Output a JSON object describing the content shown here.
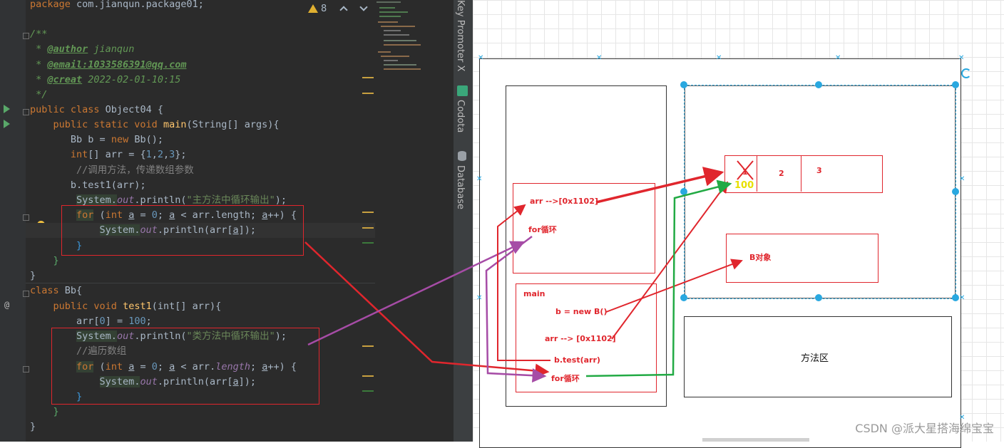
{
  "editor": {
    "warning_count": "8",
    "lines": {
      "pkg_kw": "package",
      "pkg_name": " com.jianqun.package01;",
      "doc_open": "/**",
      "doc_author_tag": "@author",
      "doc_author_val": " jianqun",
      "doc_email_tag": "@email:1033586391@qq.com",
      "doc_creat_tag": "@creat",
      "doc_creat_val": " 2022-02-01-10:15",
      "doc_close": " */",
      "class1_kw": "public class",
      "class1_name": " Object04 {",
      "main_kw": "public static void",
      "main_fn": "main",
      "main_args": "(String[] args){",
      "bb_decl": "Bb b = ",
      "kw_new": "new",
      "bb_ctor": " Bb();",
      "arr_type": "int",
      "arr_decl": "[] arr = {",
      "n1": "1",
      "n2": "2",
      "n3": "3",
      "arr_end": "};",
      "cmt_call": "//调用方法，传递数组参数",
      "call_test1": "b.test1(arr);",
      "sys": "System.",
      "out": "out",
      "println_open": ".println(",
      "str_main": "\"主方法中循环输出\"",
      "close_paren": ");",
      "kw_for": "for",
      "kw_int": "int",
      "var_a": "a",
      "zero": "0",
      "for_cond": " < arr.",
      "length": "length",
      "for_inc": "++) {",
      "arr_a": "arr[",
      "arr_a_end": "]);",
      "brace_close": "}",
      "class2_kw": "class",
      "class2_name": " Bb{",
      "test1_kw": "public void",
      "test1_fn": "test1",
      "test1_args": "(int[] arr){",
      "arr0": "arr[",
      "arr0_idx": "0",
      "arr0_assign": "] = ",
      "hundred": "100",
      "semi": ";",
      "str_class": "\"类方法中循环输出\"",
      "cmt_iter": "//遍历数组"
    }
  },
  "tool_windows": [
    "Key Promoter X",
    "Codota",
    "Database"
  ],
  "diagram": {
    "arr_ref_heap": "arr -->[0x1102]",
    "for_loop_top": "for循环",
    "main_frame": "main",
    "b_new": "b = new B()",
    "arr_ref_main": "arr --> [0x1102]",
    "b_test": "b.test(arr)",
    "for_loop_bottom": "for循环",
    "cell1": "1",
    "cell1_new": "100",
    "cell2": "2",
    "cell3": "3",
    "b_object": "B对象",
    "method_area": "方法区"
  },
  "watermark": "CSDN @派大星搭海绵宝宝",
  "colors": {
    "editor_bg": "#2b2b2b",
    "keyword": "#cc7832",
    "annotation_red": "#e0262d",
    "arrow_purple": "#a64ca6",
    "arrow_green": "#22aa44",
    "selection_blue": "#29a8e0",
    "value_yellow": "#e8e000"
  }
}
